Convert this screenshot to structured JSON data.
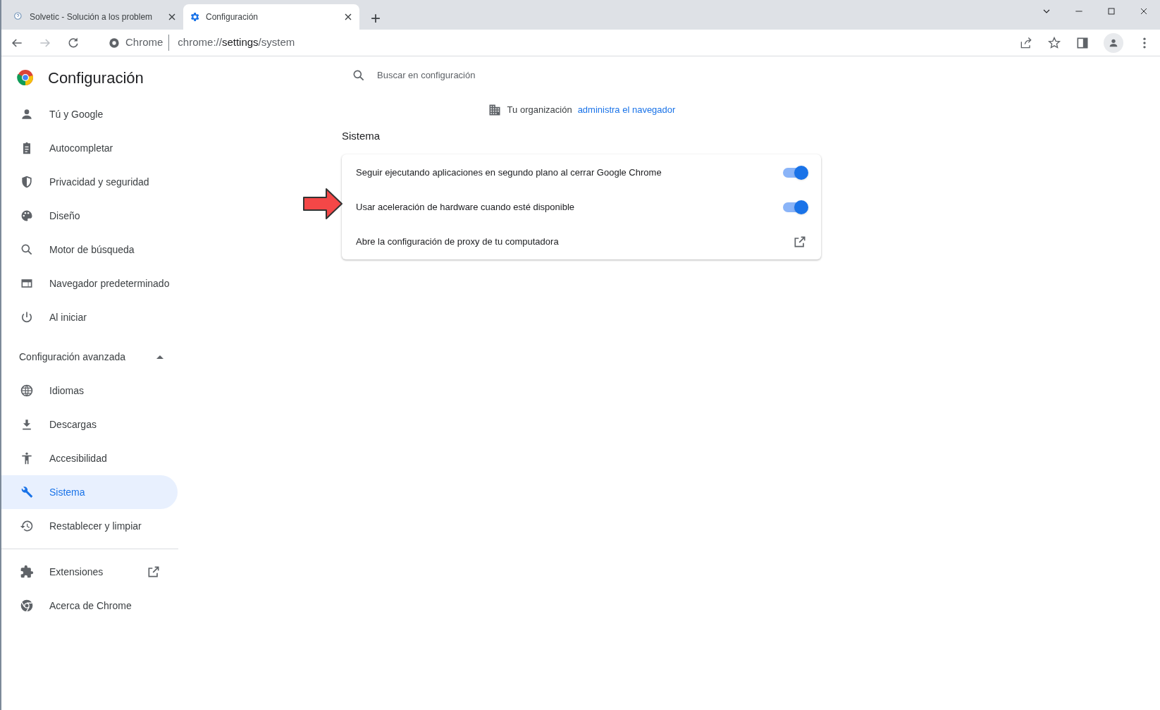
{
  "browser": {
    "tabs": [
      {
        "title": "Solvetic - Solución a los problem",
        "selected": false
      },
      {
        "title": "Configuración",
        "selected": true
      }
    ],
    "new_tab": "+",
    "omnibox": {
      "site": "Chrome",
      "url_prefix": "chrome://",
      "url_host": "settings",
      "url_path": "/system"
    }
  },
  "sidebar": {
    "title": "Configuración",
    "items": [
      {
        "label": "Tú y Google",
        "selected": false
      },
      {
        "label": "Autocompletar",
        "selected": false
      },
      {
        "label": "Privacidad y seguridad",
        "selected": false
      },
      {
        "label": "Diseño",
        "selected": false
      },
      {
        "label": "Motor de búsqueda",
        "selected": false
      },
      {
        "label": "Navegador predeterminado",
        "selected": false
      },
      {
        "label": "Al iniciar",
        "selected": false
      }
    ],
    "advanced": {
      "label": "Configuración avanzada",
      "expanded": true,
      "items": [
        {
          "label": "Idiomas",
          "selected": false
        },
        {
          "label": "Descargas",
          "selected": false
        },
        {
          "label": "Accesibilidad",
          "selected": false
        },
        {
          "label": "Sistema",
          "selected": true
        },
        {
          "label": "Restablecer y limpiar",
          "selected": false
        }
      ]
    },
    "footer_items": [
      {
        "label": "Extensiones",
        "kind": "external"
      },
      {
        "label": "Acerca de Chrome",
        "kind": "plain"
      }
    ]
  },
  "search": {
    "placeholder": "Buscar en configuración"
  },
  "managed_notice": {
    "text": "Tu organización",
    "link": "administra el navegador"
  },
  "section": {
    "title": "Sistema",
    "rows": [
      {
        "kind": "toggle",
        "label": "Seguir ejecutando aplicaciones en segundo plano al cerrar Google Chrome",
        "on": true
      },
      {
        "kind": "toggle",
        "label": "Usar aceleración de hardware cuando esté disponible",
        "on": true,
        "highlighted": true
      },
      {
        "kind": "link",
        "label": "Abre la configuración de proxy de tu computadora"
      }
    ]
  }
}
